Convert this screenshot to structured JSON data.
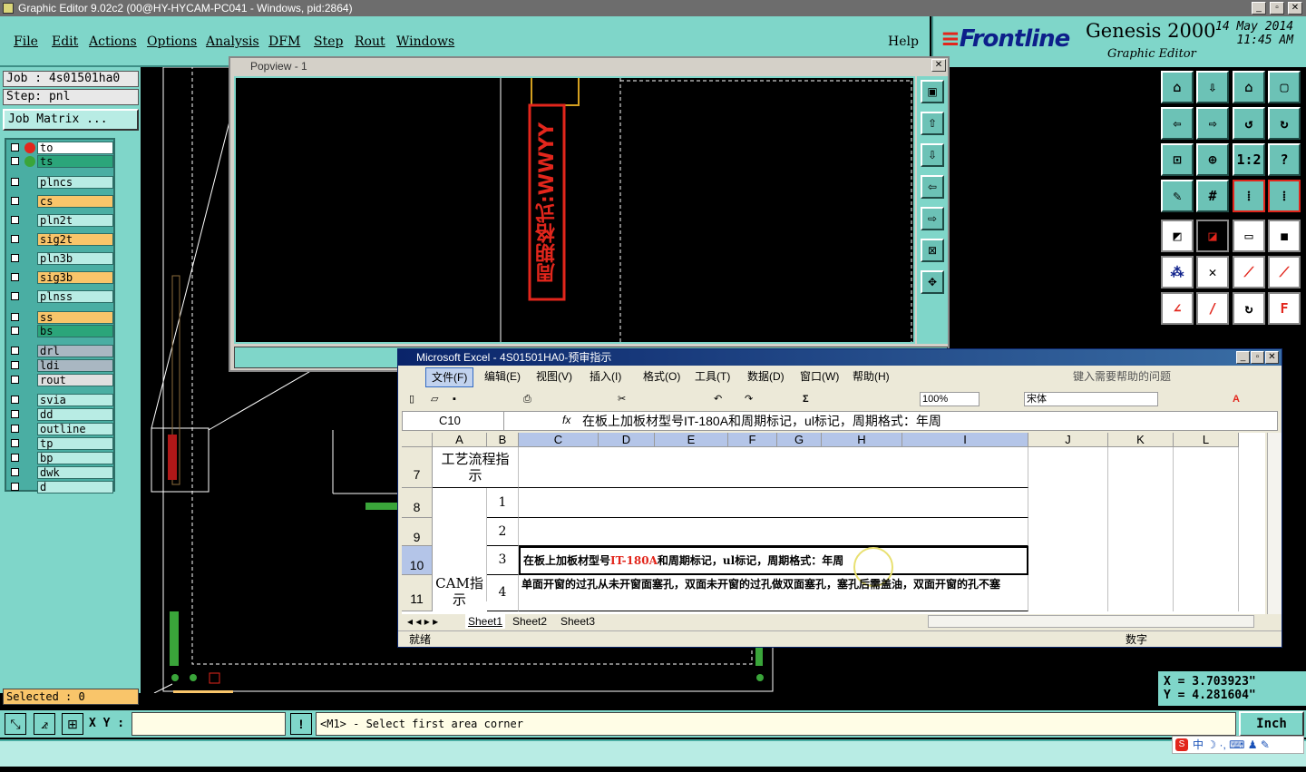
{
  "window": {
    "title": "Graphic Editor 9.02c2 (00@HY-HYCAM-PC041 - Windows, pid:2864)"
  },
  "menu": {
    "items": [
      "File",
      "Edit",
      "Actions",
      "Options",
      "Analysis",
      "DFM",
      "Step",
      "Rout",
      "Windows"
    ],
    "help": "Help"
  },
  "brand": {
    "logo": "Frontline",
    "product": "Genesis 2000",
    "subtitle": "Graphic Editor",
    "date": "14 May 2014",
    "time": "11:45 AM"
  },
  "job": {
    "job_label": "Job : 4s01501ha0",
    "step_label": "Step: pnl",
    "matrix_button": "Job Matrix ..."
  },
  "layers": [
    {
      "name": "to",
      "color": "#ffffff",
      "dot": "#e2261c"
    },
    {
      "name": "ts",
      "color": "#2ba57a",
      "dot": "#3aa53a"
    },
    {
      "name": "plncs",
      "color": "#b8ece4",
      "dot": ""
    },
    {
      "name": "cs",
      "color": "#f9c56a",
      "dot": ""
    },
    {
      "name": "pln2t",
      "color": "#b8ece4",
      "dot": ""
    },
    {
      "name": "sig2t",
      "color": "#f9c56a",
      "dot": ""
    },
    {
      "name": "pln3b",
      "color": "#b8ece4",
      "dot": ""
    },
    {
      "name": "sig3b",
      "color": "#f9c56a",
      "dot": ""
    },
    {
      "name": "plnss",
      "color": "#b8ece4",
      "dot": ""
    },
    {
      "name": "ss",
      "color": "#f9c56a",
      "dot": ""
    },
    {
      "name": "bs",
      "color": "#2ba57a",
      "dot": ""
    },
    {
      "name": "drl",
      "color": "#a9b7c2",
      "dot": ""
    },
    {
      "name": "ldi",
      "color": "#a9b7c2",
      "dot": ""
    },
    {
      "name": "rout",
      "color": "#e0e0e0",
      "dot": ""
    },
    {
      "name": "svia",
      "color": "#b8ece4",
      "dot": ""
    },
    {
      "name": "dd",
      "color": "#b8ece4",
      "dot": ""
    },
    {
      "name": "outline",
      "color": "#b8ece4",
      "dot": ""
    },
    {
      "name": "tp",
      "color": "#b8ece4",
      "dot": ""
    },
    {
      "name": "bp",
      "color": "#b8ece4",
      "dot": ""
    },
    {
      "name": "dwk",
      "color": "#b8ece4",
      "dot": ""
    },
    {
      "name": "d",
      "color": "#b8ece4",
      "dot": ""
    }
  ],
  "selected_label": "Selected : 0",
  "coords": {
    "x": "X =  3.703923\"",
    "y": "Y =  4.281604\""
  },
  "bottom": {
    "xy_label": "X Y :",
    "xy_value": "",
    "prompt": "<M1> - Select first area corner",
    "units": "Inch"
  },
  "popview": {
    "title": "Popview - 1",
    "vertical_text": "周期格式:WWYY"
  },
  "excel": {
    "title": "Microsoft Excel - 4S01501HA0-预审指示",
    "menu": [
      "文件(F)",
      "编辑(E)",
      "视图(V)",
      "插入(I)",
      "格式(O)",
      "工具(T)",
      "数据(D)",
      "窗口(W)",
      "帮助(H)"
    ],
    "help_search": "键入需要帮助的问题",
    "zoom": "100%",
    "font": "宋体",
    "name_box": "C10",
    "fx": "fx",
    "formula": "在板上加板材型号IT-180A和周期标记，ul标记，周期格式：年周",
    "columns": [
      "A",
      "B",
      "C",
      "D",
      "E",
      "F",
      "G",
      "H",
      "I",
      "J",
      "K",
      "L"
    ],
    "rows": [
      {
        "num": "7",
        "a": "工艺流程指示",
        "b": "",
        "c": ""
      },
      {
        "num": "8",
        "a": "",
        "b": "1",
        "c": ""
      },
      {
        "num": "9",
        "a": "",
        "b": "2",
        "c": ""
      },
      {
        "num": "10",
        "a": "",
        "b": "3",
        "c_pre": "在板上加板材型号",
        "c_red": "IT-180A",
        "c_post": "和周期标记，ul标记，周期格式：年周"
      },
      {
        "num": "11",
        "a": "CAM指示",
        "b": "4",
        "c": "单面开窗的过孔从未开窗面塞孔，双面未开窗的过孔做双面塞孔，塞孔后需盖油，双面开窗的孔不塞"
      }
    ],
    "sheets": [
      "Sheet1",
      "Sheet2",
      "Sheet3"
    ],
    "status_left": "就绪",
    "status_right": "数字"
  },
  "ime": {
    "label": "中"
  }
}
